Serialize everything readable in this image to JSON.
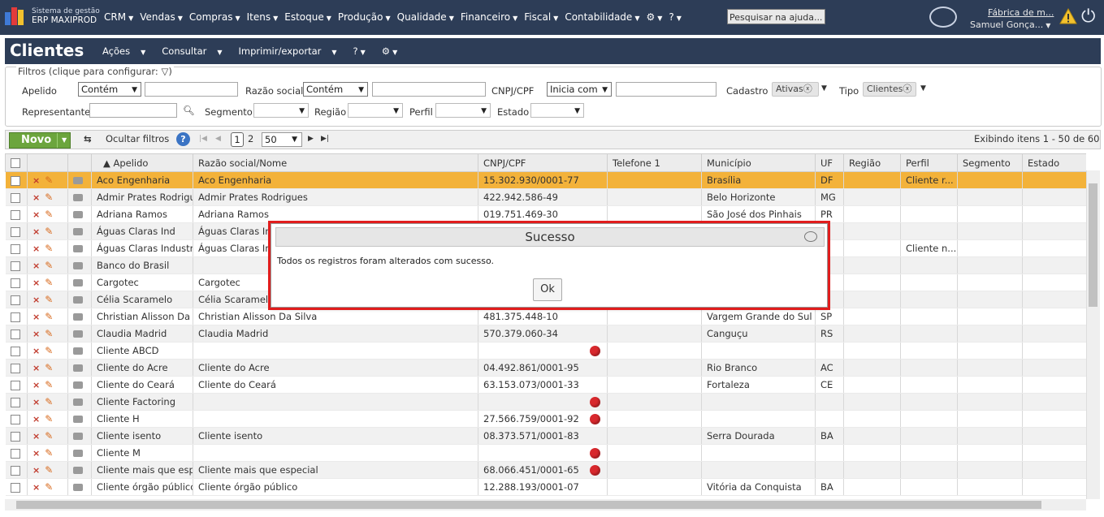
{
  "topbar": {
    "brand_line1": "Sistema de gestão",
    "brand_line2": "ERP MAXIPROD",
    "menu": [
      "CRM",
      "Vendas",
      "Compras",
      "Itens",
      "Estoque",
      "Produção",
      "Qualidade",
      "Financeiro",
      "Fiscal",
      "Contabilidade"
    ],
    "help_placeholder": "Pesquisar na ajuda...",
    "company": "Fábrica de m...",
    "user": "Samuel Gonça..."
  },
  "page": {
    "title": "Clientes",
    "actions": [
      "Ações",
      "Consultar",
      "Imprimir/exportar"
    ]
  },
  "filters": {
    "legend": "Filtros (clique para configurar:",
    "apelido_label": "Apelido",
    "apelido_mode": "Contém",
    "razao_label": "Razão social",
    "razao_mode": "Contém",
    "cnpj_label": "CNPJ/CPF",
    "cnpj_mode": "Inicia com",
    "cadastro_label": "Cadastro",
    "cadastro_value": "Ativas",
    "tipo_label": "Tipo",
    "tipo_value": "Clientes",
    "representante_label": "Representante",
    "segmento_label": "Segmento",
    "regiao_label": "Região",
    "perfil_label": "Perfil",
    "estado_label": "Estado"
  },
  "toolbar": {
    "novo_label": "Novo",
    "hide_filters_label": "Ocultar filtros",
    "page_current": "1",
    "page_next": "2",
    "page_size": "50",
    "showing_text": "Exibindo itens 1 - 50 de 60"
  },
  "grid": {
    "headers": [
      "▲ Apelido",
      "Razão social/Nome",
      "CNPJ/CPF",
      "Telefone 1",
      "Município",
      "UF",
      "Região",
      "Perfil",
      "Segmento",
      "Estado"
    ],
    "rows": [
      {
        "apelido": "Aco Engenharia",
        "razao": "Aco Engenharia",
        "cnpj": "15.302.930/0001-77",
        "mun": "Brasília",
        "uf": "DF",
        "perfil": "Cliente r...",
        "dot": false
      },
      {
        "apelido": "Admir Prates Rodrigu",
        "razao": "Admir Prates Rodrigues",
        "cnpj": "422.942.586-49",
        "mun": "Belo Horizonte",
        "uf": "MG",
        "perfil": "",
        "dot": false
      },
      {
        "apelido": "Adriana Ramos",
        "razao": "Adriana Ramos",
        "cnpj": "019.751.469-30",
        "mun": "São José dos Pinhais",
        "uf": "PR",
        "perfil": "",
        "dot": false
      },
      {
        "apelido": "Águas Claras Ind",
        "razao": "Águas Claras In",
        "cnpj": "",
        "mun": "",
        "uf": "",
        "perfil": "",
        "dot": false
      },
      {
        "apelido": "Águas Claras Industri",
        "razao": "Águas Claras In",
        "cnpj": "",
        "mun": "",
        "uf": "",
        "perfil": "Cliente n...",
        "dot": false
      },
      {
        "apelido": "Banco do Brasil",
        "razao": "",
        "cnpj": "",
        "mun": "",
        "uf": "",
        "perfil": "",
        "dot": false
      },
      {
        "apelido": "Cargotec",
        "razao": "Cargotec",
        "cnpj": "",
        "mun": "",
        "uf": "",
        "perfil": "",
        "dot": false
      },
      {
        "apelido": "Célia Scaramelo",
        "razao": "Célia Scaramelo",
        "cnpj": "",
        "mun": "",
        "uf": "S",
        "perfil": "",
        "dot": false
      },
      {
        "apelido": "Christian Alisson Da S",
        "razao": "Christian Alisson Da Silva",
        "cnpj": "481.375.448-10",
        "mun": "Vargem Grande do Sul",
        "uf": "SP",
        "perfil": "",
        "dot": false
      },
      {
        "apelido": "Claudia Madrid",
        "razao": "Claudia Madrid",
        "cnpj": "570.379.060-34",
        "mun": "Canguçu",
        "uf": "RS",
        "perfil": "",
        "dot": false
      },
      {
        "apelido": "Cliente ABCD",
        "razao": "",
        "cnpj": "",
        "mun": "",
        "uf": "",
        "perfil": "",
        "dot": true
      },
      {
        "apelido": "Cliente do Acre",
        "razao": "Cliente do Acre",
        "cnpj": "04.492.861/0001-95",
        "mun": "Rio Branco",
        "uf": "AC",
        "perfil": "",
        "dot": false
      },
      {
        "apelido": "Cliente do Ceará",
        "razao": "Cliente do Ceará",
        "cnpj": "63.153.073/0001-33",
        "mun": "Fortaleza",
        "uf": "CE",
        "perfil": "",
        "dot": false
      },
      {
        "apelido": "Cliente Factoring",
        "razao": "",
        "cnpj": "",
        "mun": "",
        "uf": "",
        "perfil": "",
        "dot": true
      },
      {
        "apelido": "Cliente H",
        "razao": "",
        "cnpj": "27.566.759/0001-92",
        "mun": "",
        "uf": "",
        "perfil": "",
        "dot": true
      },
      {
        "apelido": "Cliente isento",
        "razao": "Cliente isento",
        "cnpj": "08.373.571/0001-83",
        "mun": "Serra Dourada",
        "uf": "BA",
        "perfil": "",
        "dot": false
      },
      {
        "apelido": "Cliente M",
        "razao": "",
        "cnpj": "",
        "mun": "",
        "uf": "",
        "perfil": "",
        "dot": true
      },
      {
        "apelido": "Cliente mais que espe",
        "razao": "Cliente mais que especial",
        "cnpj": "68.066.451/0001-65",
        "mun": "",
        "uf": "",
        "perfil": "",
        "dot": true
      },
      {
        "apelido": "Cliente órgão público",
        "razao": "Cliente órgão público",
        "cnpj": "12.288.193/0001-07",
        "mun": "Vitória da Conquista",
        "uf": "BA",
        "perfil": "",
        "dot": false
      }
    ]
  },
  "dialog": {
    "title": "Sucesso",
    "message": "Todos os registros foram alterados com sucesso.",
    "ok_label": "Ok"
  },
  "colors": {
    "topbar": "#2d3d57",
    "selected_row": "#f3b23a",
    "novo_button": "#6ca53d",
    "highlight_frame": "#e11d1d"
  }
}
